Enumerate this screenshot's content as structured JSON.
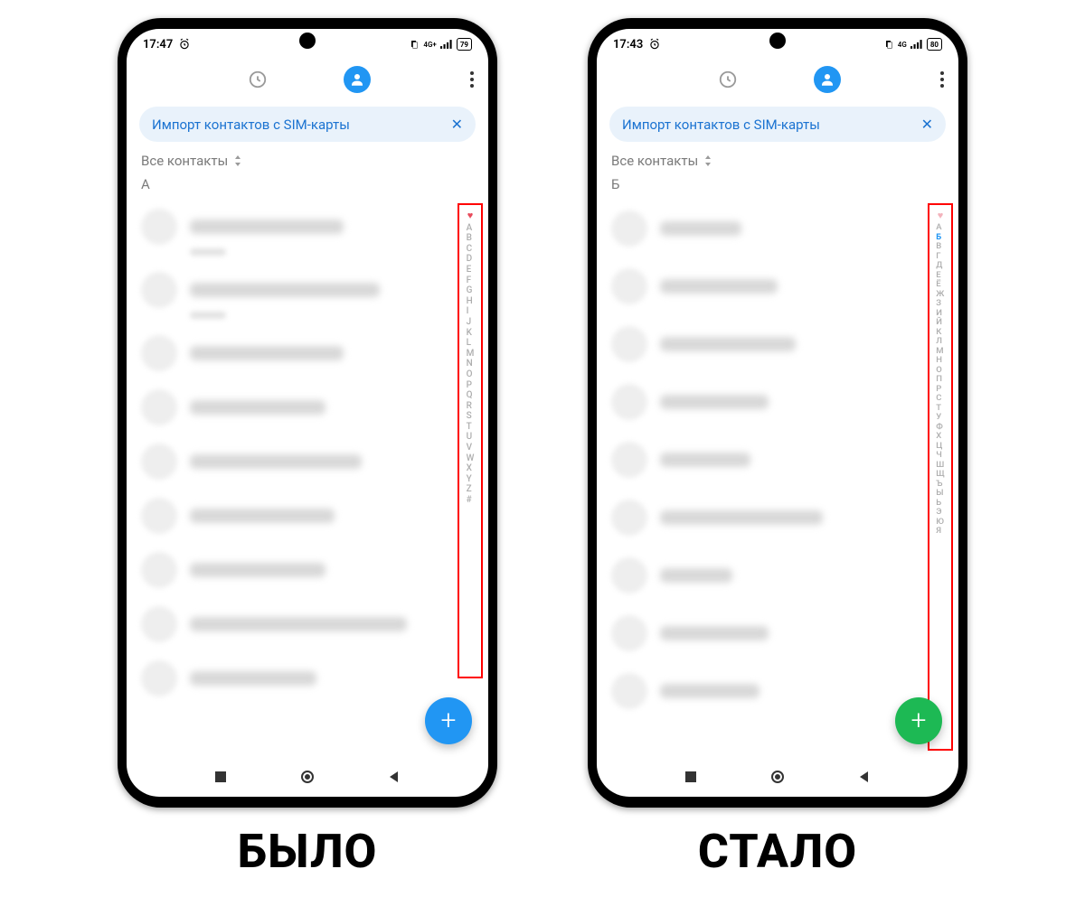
{
  "captions": {
    "before": "БЫЛО",
    "after": "СТАЛО"
  },
  "status": {
    "before": {
      "time": "17:47",
      "battery": "79"
    },
    "after": {
      "time": "17:43",
      "battery": "80"
    }
  },
  "chip_text": "Импорт контактов с SIM-карты",
  "filter_label": "Все контакты",
  "section": {
    "before": "А",
    "after": "Б"
  },
  "scrollbar": {
    "latin": [
      "A",
      "B",
      "C",
      "D",
      "E",
      "F",
      "G",
      "H",
      "I",
      "J",
      "K",
      "L",
      "M",
      "N",
      "O",
      "P",
      "Q",
      "R",
      "S",
      "T",
      "U",
      "V",
      "W",
      "X",
      "Y",
      "Z",
      "#"
    ],
    "cyrillic": [
      "А",
      "Б",
      "В",
      "Г",
      "Д",
      "Е",
      "Ё",
      "Ж",
      "З",
      "И",
      "Й",
      "К",
      "Л",
      "М",
      "Н",
      "О",
      "П",
      "Р",
      "С",
      "Т",
      "У",
      "Ф",
      "Х",
      "Ц",
      "Ч",
      "Ш",
      "Щ",
      "Ъ",
      "Ы",
      "Ь",
      "Э",
      "Ю",
      "Я"
    ],
    "cyr_active": "Б"
  },
  "contact_widths": {
    "before": [
      170,
      10,
      210,
      10,
      170,
      150,
      190,
      160,
      150,
      240,
      140
    ],
    "after": [
      90,
      130,
      150,
      120,
      100,
      180,
      80,
      120,
      110
    ]
  },
  "colors": {
    "accent_blue": "#2196f3",
    "accent_green": "#1db954",
    "chip_bg": "#e9f2fb",
    "highlight_red": "#ff0000"
  }
}
